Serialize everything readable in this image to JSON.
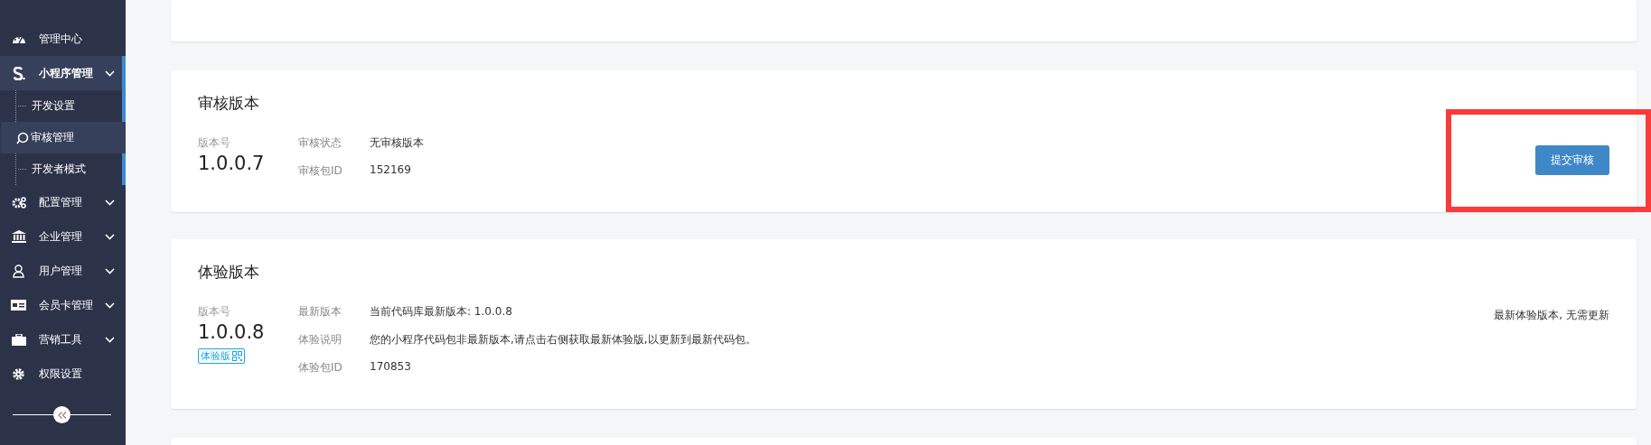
{
  "sidebar": {
    "items": [
      {
        "label": "管理中心"
      },
      {
        "label": "小程序管理",
        "expanded": true,
        "children": [
          {
            "label": "开发设置",
            "selected": false
          },
          {
            "label": "审核管理",
            "selected": true
          },
          {
            "label": "开发者模式",
            "selected": false
          }
        ]
      },
      {
        "label": "配置管理",
        "expanded": false
      },
      {
        "label": "企业管理",
        "expanded": false
      },
      {
        "label": "用户管理",
        "expanded": false
      },
      {
        "label": "会员卡管理",
        "expanded": false
      },
      {
        "label": "营销工具",
        "expanded": false
      },
      {
        "label": "权限设置"
      }
    ]
  },
  "cards": [
    {
      "kind": "clipped"
    },
    {
      "kind": "version",
      "title": "审核版本",
      "version_label": "版本号",
      "version": "1.0.0.7",
      "fields": [
        {
          "label": "审核状态",
          "value": "无审核版本"
        },
        {
          "label": "审核包ID",
          "value": "152169"
        }
      ],
      "action": {
        "kind": "button",
        "label": "提交审核"
      },
      "highlighted": true
    },
    {
      "kind": "version",
      "title": "体验版本",
      "version_label": "版本号",
      "version": "1.0.0.8",
      "tag": "体验版",
      "fields": [
        {
          "label": "最新版本",
          "value": "当前代码库最新版本: 1.0.0.8"
        },
        {
          "label": "体验说明",
          "value": "您的小程序代码包非最新版本,请点击右侧获取最新体验版,以更新到最新代码包。"
        },
        {
          "label": "体验包ID",
          "value": "170853"
        }
      ],
      "action": {
        "kind": "note",
        "label": "最新体验版本, 无需更新"
      },
      "highlighted": false
    },
    {
      "kind": "empty"
    }
  ]
}
